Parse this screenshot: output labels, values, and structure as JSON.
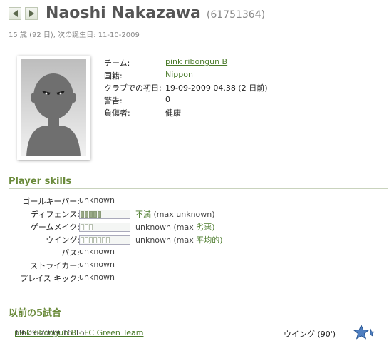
{
  "player": {
    "name": "Naoshi Nakazawa",
    "id": "(61751364)",
    "subtitle": "15 歳 (92 日), 次の誕生日: 11-10-2009"
  },
  "info": {
    "rows": [
      {
        "label": "チーム:",
        "value": "pink ribongun B",
        "link": true
      },
      {
        "label": "国籍:",
        "value": "Nippon",
        "link": true
      },
      {
        "label": "クラブでの初日:",
        "value": "19-09-2009 04.38 (2 日前)",
        "link": false
      },
      {
        "label": "警告:",
        "value": "0",
        "link": false
      },
      {
        "label": "負傷者:",
        "value": "健康",
        "link": false
      }
    ]
  },
  "skills": {
    "title": "Player skills",
    "items": [
      {
        "label": "ゴールキーパー:",
        "value": "unknown"
      },
      {
        "label": "ディフェンス:",
        "level_word": "不満",
        "max_prefix": "(max",
        "max_value": "unknown)",
        "filled": 5
      },
      {
        "label": "ゲームメイク:",
        "value": "unknown",
        "max_prefix": "(max",
        "max_value": "劣悪)",
        "filled": 0
      },
      {
        "label": "ウイング:",
        "value": "unknown",
        "max_prefix": "(max",
        "max_value": "平均的)",
        "filled": 0
      },
      {
        "label": "パス:",
        "value": "unknown"
      },
      {
        "label": "ストライカー:",
        "value": "unknown"
      },
      {
        "label": "プレイス キック:",
        "value": "unknown"
      }
    ]
  },
  "games": {
    "title": "以前の5試合",
    "matches": [
      {
        "date": "19-09-2009 16.15",
        "teams": "pink ribongun B - FC Green Team",
        "position": "ウイング (90')",
        "rating_stars": 2.5
      }
    ]
  },
  "icons": {
    "prev": "arrow-left-icon",
    "next": "arrow-right-icon",
    "silhouette": "player-silhouette-icon",
    "star": "rating-star-icon"
  },
  "colors": {
    "accent": "#6a8a3a",
    "link": "#4a7a2a",
    "name": "#555555"
  }
}
